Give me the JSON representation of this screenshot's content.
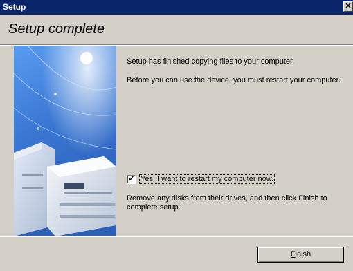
{
  "window": {
    "title": "Setup",
    "close_symbol": "✕"
  },
  "header": {
    "heading": "Setup complete"
  },
  "body": {
    "message_1": "Setup has finished copying files to your computer.",
    "message_2": "Before you can use the device, you must restart your computer.",
    "restart_checkbox": {
      "checked": true,
      "label": "Yes, I want to restart my computer now."
    },
    "message_3": "Remove any disks from their drives, and then click Finish to complete setup."
  },
  "footer": {
    "finish_accel": "F",
    "finish_rest": "inish"
  },
  "icons": [
    "close-icon",
    "check-icon",
    "printer-illustration"
  ],
  "colors": {
    "titlebar": "#0a246a",
    "dialog": "#d4d0c8",
    "banner_blue": "#3f7fd8"
  }
}
